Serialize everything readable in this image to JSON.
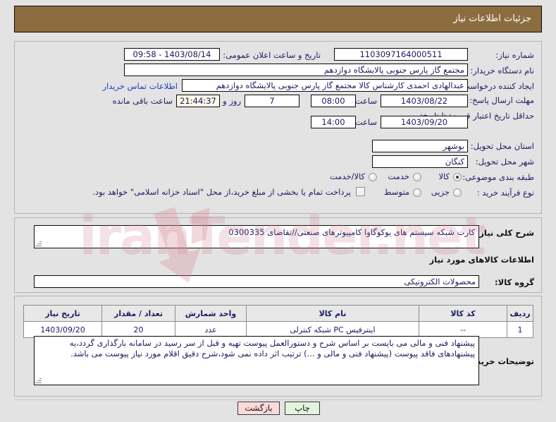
{
  "header": {
    "title": "جزئیات اطلاعات نیاز",
    "bar_color": "#8c6d40"
  },
  "need_info": {
    "need_number_label": "شماره نیاز:",
    "need_number_value": "1103097164000511",
    "announce_datetime_label": "تاریخ و ساعت اعلان عمومی:",
    "announce_datetime_value": "1403/08/14 - 09:58",
    "buyer_org_label": "نام دستگاه خریدار:",
    "buyer_org_value": "مجتمع گاز پارس جنوبی  پالایشگاه دوازدهم",
    "requester_label": "ایجاد کننده درخواست:",
    "requester_value": "عبدالهادی احمدی کارشناس کالا مجتمع گاز پارس جنوبی  پالایشگاه دوازدهم",
    "contact_link": "اطلاعات تماس خریدار",
    "reply_deadline_label": "مهلت ارسال پاسخ: تا تاریخ:",
    "reply_deadline_date": "1403/08/22",
    "reply_deadline_time_label": "ساعت",
    "reply_deadline_time": "08:00",
    "remaining_days": "7",
    "remaining_days_sep": "روز و",
    "remaining_clock": "21:44:37",
    "remaining_suffix": "ساعت باقی مانده",
    "price_validity_label": "حداقل تاریخ اعتبار قیمت: تا تاریخ:",
    "price_validity_date": "1403/09/20",
    "price_validity_time_label": "ساعت",
    "price_validity_time": "14:00",
    "province_label": "استان محل تحویل:",
    "province_value": "بوشهر",
    "city_label": "شهر محل تحویل:",
    "city_value": "کنگان",
    "classification_label": "طبقه بندی موضوعی:",
    "classification_options": [
      "کالا",
      "خدمت",
      "کالا/خدمت"
    ],
    "classification_selected": "کالا",
    "process_type_label": "نوع فرآیند خرید :",
    "process_type_options": [
      "جزیی",
      "متوسط"
    ],
    "process_type_selected": "",
    "treasury_checkbox_label": "پرداخت تمام یا بخشی از مبلغ خرید،از محل \"اسناد خزانه اسلامی\" خواهد بود.",
    "treasury_checkbox_checked": false
  },
  "summary": {
    "label": "شرح کلی نیاز:",
    "value": "کارت شبکه سیستم های یوکوگاوا کامپیوترهای صنعتی//تقاضای 0300335"
  },
  "goods_section": {
    "heading": "اطلاعات کالاهای مورد نیاز",
    "group_label": "گروه کالا:",
    "group_value": "محصولات الکترونیکی"
  },
  "items_table": {
    "columns": [
      "ردیف",
      "کد کالا",
      "نام کالا",
      "واحد شمارش",
      "تعداد / مقدار",
      "تاریخ نیاز"
    ],
    "rows": [
      {
        "row": "1",
        "code": "--",
        "name": "اینترفیس PC شبکه کنترلی",
        "unit": "عدد",
        "quantity": "20",
        "need_date": "1403/09/20"
      }
    ]
  },
  "buyer_notes": {
    "label": "توضیحات خریدار:",
    "value": "پیشنهاد فنی و مالی می بایست بر اساس شرح و دستورالعمل پیوست تهیه و قبل از سر رسید در سامانه بارگذاری گردد،به پیشنهادهای فاقد پیوست (پیشنهاد فنی و مالی و ...) ترتیب اثر داده نمی شود،شرح دقیق اقلام مورد نیاز پیوست می باشد."
  },
  "footer": {
    "print_label": "چاپ",
    "back_label": "بازگشت"
  },
  "watermark": {
    "text": "iranTender.net"
  }
}
